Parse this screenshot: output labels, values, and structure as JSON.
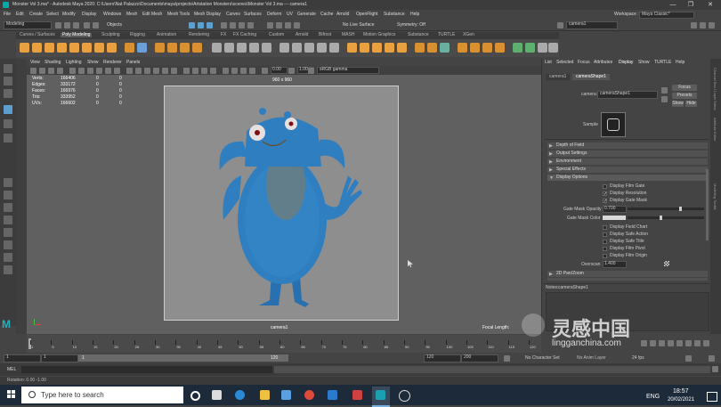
{
  "window": {
    "title": "Monster Vol 3.ma* - Autodesk Maya 2020: C:\\Users\\Nat Palazzo\\Documents\\maya\\projects\\Artstation Monsters\\scenes\\Monster Vol 3.ma  ---  camera1",
    "minimize": "—",
    "maximize": "❐",
    "close": "✕"
  },
  "menubar": [
    "File",
    "Edit",
    "Create",
    "Select",
    "Modify",
    "Display",
    "Windows",
    "Mesh",
    "Edit Mesh",
    "Mesh Tools",
    "Mesh Display",
    "Curves",
    "Surfaces",
    "Deform",
    "UV",
    "Generate",
    "Cache",
    "Arnold",
    "OpenFlight",
    "Substance",
    "Help"
  ],
  "workspace": {
    "label": "Workspace :",
    "value": "Maya Classic*"
  },
  "statusline": {
    "menuset": "Modeling",
    "objects": "Objects",
    "no_live_surface": "No Live Surface",
    "symmetry": "Symmetry: Off",
    "camera_field": "camera1"
  },
  "shelf": {
    "tabs": [
      "Curves / Surfaces",
      "Poly Modeling",
      "Sculpting",
      "Rigging",
      "Animation",
      "Rendering",
      "FX",
      "FX Caching",
      "Custom",
      "Arnold",
      "Bifrost",
      "MASH",
      "Motion Graphics",
      "Substance",
      "TURTLE",
      "XGen"
    ],
    "active_tab": "Poly Modeling"
  },
  "viewport": {
    "menu": [
      "View",
      "Shading",
      "Lighting",
      "Show",
      "Renderer",
      "Panels"
    ],
    "exposure": "0.00",
    "gamma": "1.00",
    "color_space": "sRGB gamma",
    "resolution": "960 x 960",
    "hud": {
      "labels": [
        "Verts:",
        "Edges:",
        "Faces:",
        "Tris:",
        "UVs:"
      ],
      "col1": [
        "166406",
        "333172",
        "166976",
        "333952",
        "166602"
      ],
      "col2": [
        "0",
        "0",
        "0",
        "0",
        "0"
      ],
      "col3": [
        "0",
        "0",
        "0",
        "0",
        "0"
      ]
    },
    "camera_label": "camera1",
    "focal_length": "Focal Length:"
  },
  "attribute_editor": {
    "tabs": [
      "List",
      "Selected",
      "Focus",
      "Attributes",
      "Display",
      "Show",
      "TURTLE",
      "Help"
    ],
    "node_tabs": [
      "camera1",
      "cameraShape1"
    ],
    "camera_label": "camera:",
    "camera_value": "cameraShape1",
    "focus_btn": "Focus",
    "presets_btn": "Presets",
    "show_btn": "Show",
    "hide_btn": "Hide",
    "sample_label": "Sample",
    "sections": [
      "Depth of Field",
      "Output Settings",
      "Environment",
      "Special Effects",
      "Display Options"
    ],
    "checkboxes": [
      {
        "label": "Display Film Gate",
        "checked": false
      },
      {
        "label": "Display Resolution",
        "checked": true
      },
      {
        "label": "Display Gate Mask",
        "checked": true
      }
    ],
    "gate_mask_opacity_label": "Gate Mask Opacity",
    "gate_mask_opacity": "0.700",
    "gate_mask_color_label": "Gate Mask Color",
    "checkboxes2": [
      {
        "label": "Display Field Chart",
        "checked": false
      },
      {
        "label": "Display Safe Action",
        "checked": false
      },
      {
        "label": "Display Safe Title",
        "checked": false
      },
      {
        "label": "Display Film Pivot",
        "checked": false
      },
      {
        "label": "Display Film Origin",
        "checked": false
      }
    ],
    "overscan_label": "Overscan",
    "overscan": "1.400",
    "pan_zoom": "2D Pan/Zoom",
    "notes_label": "Notes:",
    "notes_value": "cameraShape1"
  },
  "sidestrip": [
    "Attribute Editor",
    "Channel Box / Layer Editor",
    "Modelling Toolkit"
  ],
  "timeslider": {
    "ticks": [
      "1",
      "5",
      "10",
      "15",
      "20",
      "25",
      "30",
      "35",
      "40",
      "45",
      "50",
      "55",
      "60",
      "65",
      "70",
      "75",
      "80",
      "85",
      "90",
      "95",
      "100",
      "105",
      "110",
      "115",
      "120"
    ],
    "current_frame": "1"
  },
  "range": {
    "start": "1",
    "playback_start": "1",
    "range_end": "120",
    "playback_end": "120",
    "end": "200",
    "character_set": "No Character Set",
    "anim_layer": "No Anim Layer",
    "fps": "24 fps"
  },
  "mel": "MEL",
  "helpline": "Rotation: 0.00 -1.00",
  "taskbar": {
    "search_placeholder": "Type here to search",
    "time": "18:57",
    "date": "20/02/2021",
    "lang": "ENG"
  },
  "watermark": {
    "cn": "灵感中国",
    "url": "lingganchina.com"
  },
  "colors": {
    "accent": "#5da0d0",
    "monster": "#2f7fc0",
    "shelf_orange": "#e8a040"
  }
}
